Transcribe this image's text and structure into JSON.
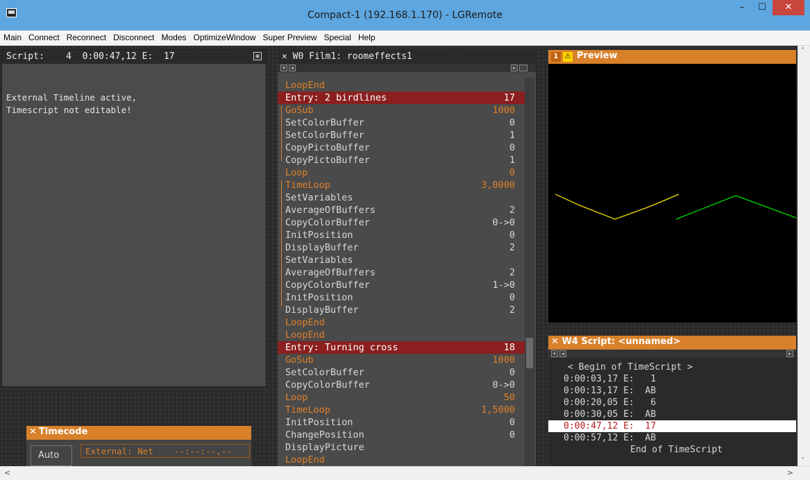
{
  "window": {
    "title": "Compact-1 (192.168.1.170) - LGRemote",
    "min": "–",
    "max": "☐",
    "close": "✕"
  },
  "menu": [
    "Main",
    "Connect",
    "Reconnect",
    "Disconnect",
    "Modes",
    "OptimizeWindow",
    "Super Preview",
    "Special",
    "Help"
  ],
  "script_panel": {
    "header": "Script:    4  0:00:47,12 E:  17",
    "message_line1": "External Timeline active,",
    "message_line2": "Timescript not editable!"
  },
  "timecode_panel": {
    "title": "Timecode",
    "auto_label": "Auto",
    "field": "External: Net    --:--:--,--"
  },
  "film_panel": {
    "title": "W0 Film1: roomeffects1",
    "rows": [
      {
        "name": "LoopEnd",
        "value": "",
        "style": "orange"
      },
      {
        "name": "Entry: 2 birdlines",
        "value": "17",
        "style": "entry"
      },
      {
        "name": "GoSub",
        "value": "1000",
        "style": "orange"
      },
      {
        "name": "SetColorBuffer",
        "value": "0",
        "style": "white"
      },
      {
        "name": "SetColorBuffer",
        "value": "1",
        "style": "white"
      },
      {
        "name": "CopyPictoBuffer",
        "value": "0",
        "style": "white"
      },
      {
        "name": "CopyPictoBuffer",
        "value": "1",
        "style": "white"
      },
      {
        "name": "Loop",
        "value": "0",
        "style": "orange"
      },
      {
        "name": "TimeLoop",
        "value": "3,0000",
        "style": "orange"
      },
      {
        "name": "SetVariables",
        "value": "",
        "style": "white"
      },
      {
        "name": "AverageOfBuffers",
        "value": "2",
        "style": "white"
      },
      {
        "name": "CopyColorBuffer",
        "value": "0->0",
        "style": "white"
      },
      {
        "name": "InitPosition",
        "value": "0",
        "style": "white"
      },
      {
        "name": "DisplayBuffer",
        "value": "2",
        "style": "white"
      },
      {
        "name": "SetVariables",
        "value": "",
        "style": "white"
      },
      {
        "name": "AverageOfBuffers",
        "value": "2",
        "style": "white"
      },
      {
        "name": "CopyColorBuffer",
        "value": "1->0",
        "style": "white"
      },
      {
        "name": "InitPosition",
        "value": "0",
        "style": "white"
      },
      {
        "name": "DisplayBuffer",
        "value": "2",
        "style": "white"
      },
      {
        "name": "LoopEnd",
        "value": "",
        "style": "orange"
      },
      {
        "name": "LoopEnd",
        "value": "",
        "style": "orange"
      },
      {
        "name": "Entry: Turning cross",
        "value": "18",
        "style": "entry"
      },
      {
        "name": "GoSub",
        "value": "1000",
        "style": "orange"
      },
      {
        "name": "SetColorBuffer",
        "value": "0",
        "style": "white"
      },
      {
        "name": "CopyColorBuffer",
        "value": "0->0",
        "style": "white"
      },
      {
        "name": "Loop",
        "value": "50",
        "style": "orange"
      },
      {
        "name": "TimeLoop",
        "value": "1,5000",
        "style": "orange"
      },
      {
        "name": "InitPosition",
        "value": "0",
        "style": "white"
      },
      {
        "name": "ChangePosition",
        "value": "0",
        "style": "white"
      },
      {
        "name": "DisplayPicture",
        "value": "",
        "style": "white"
      },
      {
        "name": "LoopEnd",
        "value": "",
        "style": "orange"
      }
    ]
  },
  "preview_panel": {
    "number": "1",
    "warn": "⚠",
    "title": "Preview",
    "line_colors": {
      "yellow": "#d4c000",
      "green": "#00c000"
    }
  },
  "w4_panel": {
    "title": "W4 Script: <unnamed>",
    "begin": "< Begin of TimeScript >",
    "rows": [
      {
        "text": "0:00:03,17 E:   1",
        "selected": false
      },
      {
        "text": "0:00:13,17 E:  AB",
        "selected": false
      },
      {
        "text": "0:00:20,05 E:   6",
        "selected": false
      },
      {
        "text": "0:00:30,05 E:  AB",
        "selected": false
      },
      {
        "text": "0:00:47,12 E:  17",
        "selected": true
      },
      {
        "text": "0:00:57,12 E:  AB",
        "selected": false
      }
    ],
    "end": "End of TimeScript"
  },
  "colors": {
    "accent": "#d8812a",
    "entry": "#8b1f1f",
    "titlebar": "#5da6e0"
  }
}
